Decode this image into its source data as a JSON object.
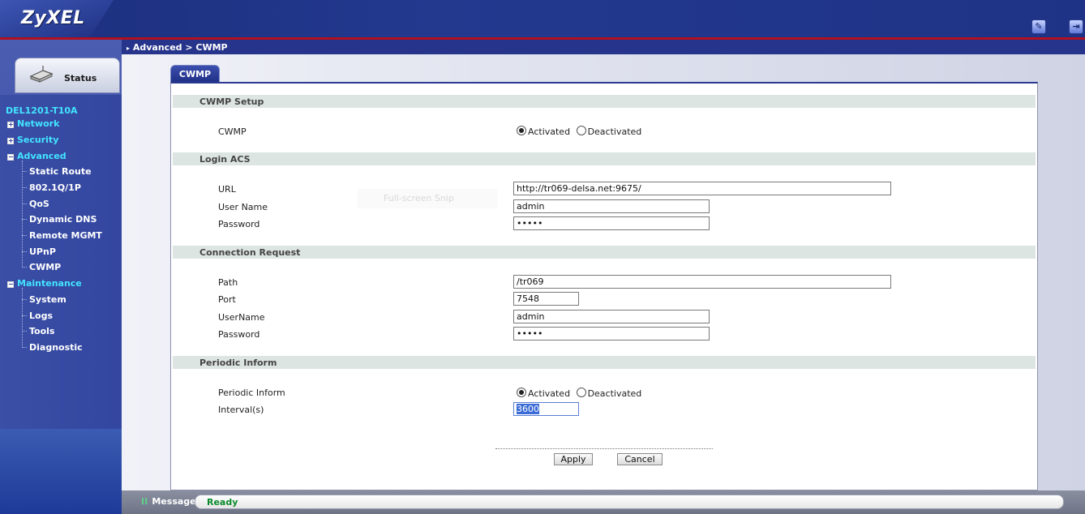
{
  "header": {
    "logo": "ZyXEL",
    "icons": [
      "wizard-icon",
      "logout-icon"
    ]
  },
  "breadcrumb": "Advanced > CWMP",
  "sidebar": {
    "status_tab": "Status",
    "device": "DEL1201-T10A",
    "groups": [
      {
        "label": "Network",
        "expanded": false
      },
      {
        "label": "Security",
        "expanded": false
      },
      {
        "label": "Advanced",
        "expanded": true,
        "items": [
          "Static Route",
          "802.1Q/1P",
          "QoS",
          "Dynamic DNS",
          "Remote MGMT",
          "UPnP",
          "CWMP"
        ]
      },
      {
        "label": "Maintenance",
        "expanded": true,
        "items": [
          "System",
          "Logs",
          "Tools",
          "Diagnostic"
        ]
      }
    ]
  },
  "tab": "CWMP",
  "cwmp_setup": {
    "title": "CWMP Setup",
    "cwmp_label": "CWMP",
    "activated": "Activated",
    "deactivated": "Deactivated",
    "selected": "Activated"
  },
  "login_acs": {
    "title": "Login ACS",
    "url_label": "URL",
    "url_value": "http://tr069-delsa.net:9675/",
    "username_label": "User Name",
    "username_value": "admin",
    "password_label": "Password",
    "password_value": "•••••"
  },
  "faded_tip": "Full-screen Snip",
  "connection_request": {
    "title": "Connection Request",
    "path_label": "Path",
    "path_value": "/tr069",
    "port_label": "Port",
    "port_value": "7548",
    "username_label": "UserName",
    "username_value": "admin",
    "password_label": "Password",
    "password_value": "•••••"
  },
  "periodic_inform": {
    "title": "Periodic Inform",
    "inform_label": "Periodic Inform",
    "activated": "Activated",
    "deactivated": "Deactivated",
    "selected": "Activated",
    "interval_label": "Interval(s)",
    "interval_value": "3600"
  },
  "buttons": {
    "apply": "Apply",
    "cancel": "Cancel"
  },
  "statusbar": {
    "label": "Message",
    "text": "Ready"
  },
  "colors": {
    "accent": "#26348c",
    "sidebar_link": "#42e5ff",
    "ready": "#0a8a2a",
    "header_line": "#b01020"
  }
}
